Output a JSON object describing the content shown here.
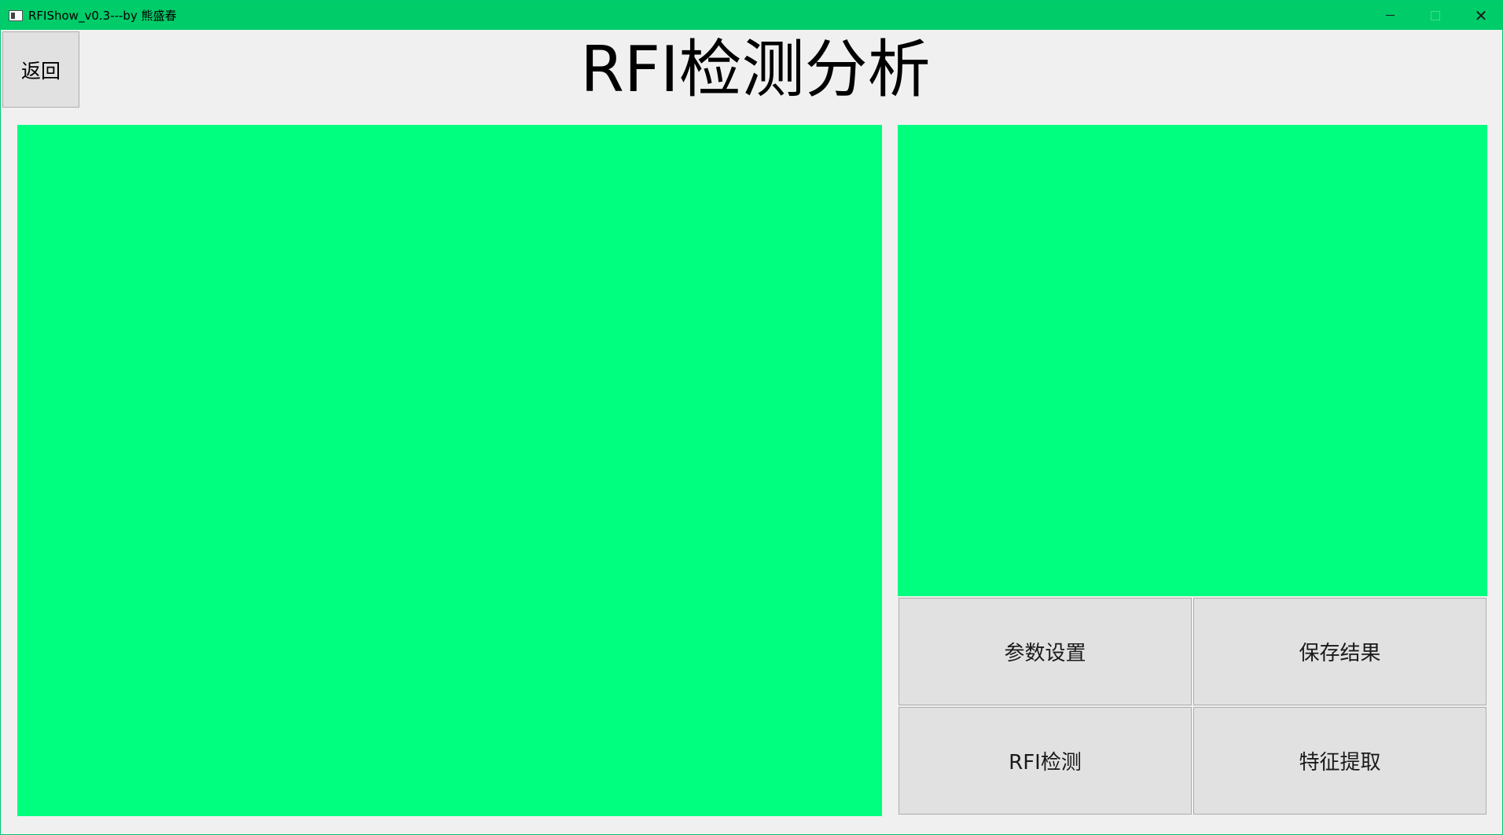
{
  "window": {
    "title": "RFIShow_v0.3---by 熊盛春",
    "theme_color": "#00cc6a"
  },
  "header": {
    "back_label": "返回",
    "page_title": "RFI检测分析"
  },
  "panels": {
    "fill_color": "#00ff7f"
  },
  "actions": {
    "params_label": "参数设置",
    "save_label": "保存结果",
    "rfi_detect_label": "RFI检测",
    "feature_extract_label": "特征提取"
  }
}
